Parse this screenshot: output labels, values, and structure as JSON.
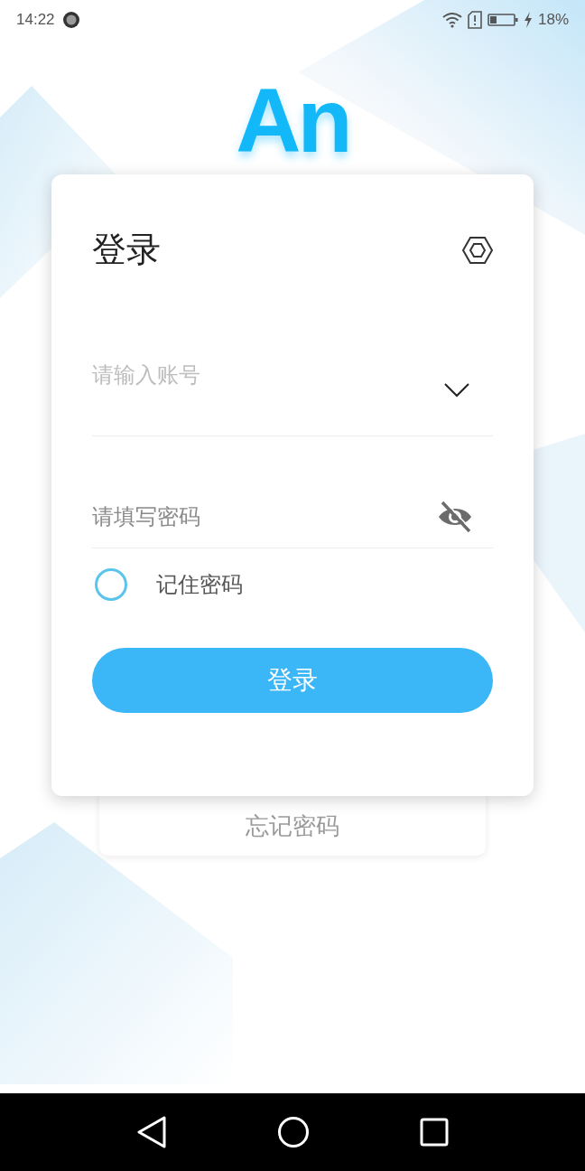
{
  "status_bar": {
    "time": "14:22",
    "battery": "18%"
  },
  "logo": {
    "text": "An"
  },
  "login_card": {
    "title": "登录",
    "account_field": {
      "placeholder": "请输入账号"
    },
    "password_field": {
      "placeholder": "请填写密码",
      "visible": false
    },
    "remember": {
      "label": "记住密码",
      "checked": false
    },
    "login_button": "登录"
  },
  "forgot_password": "忘记密码"
}
